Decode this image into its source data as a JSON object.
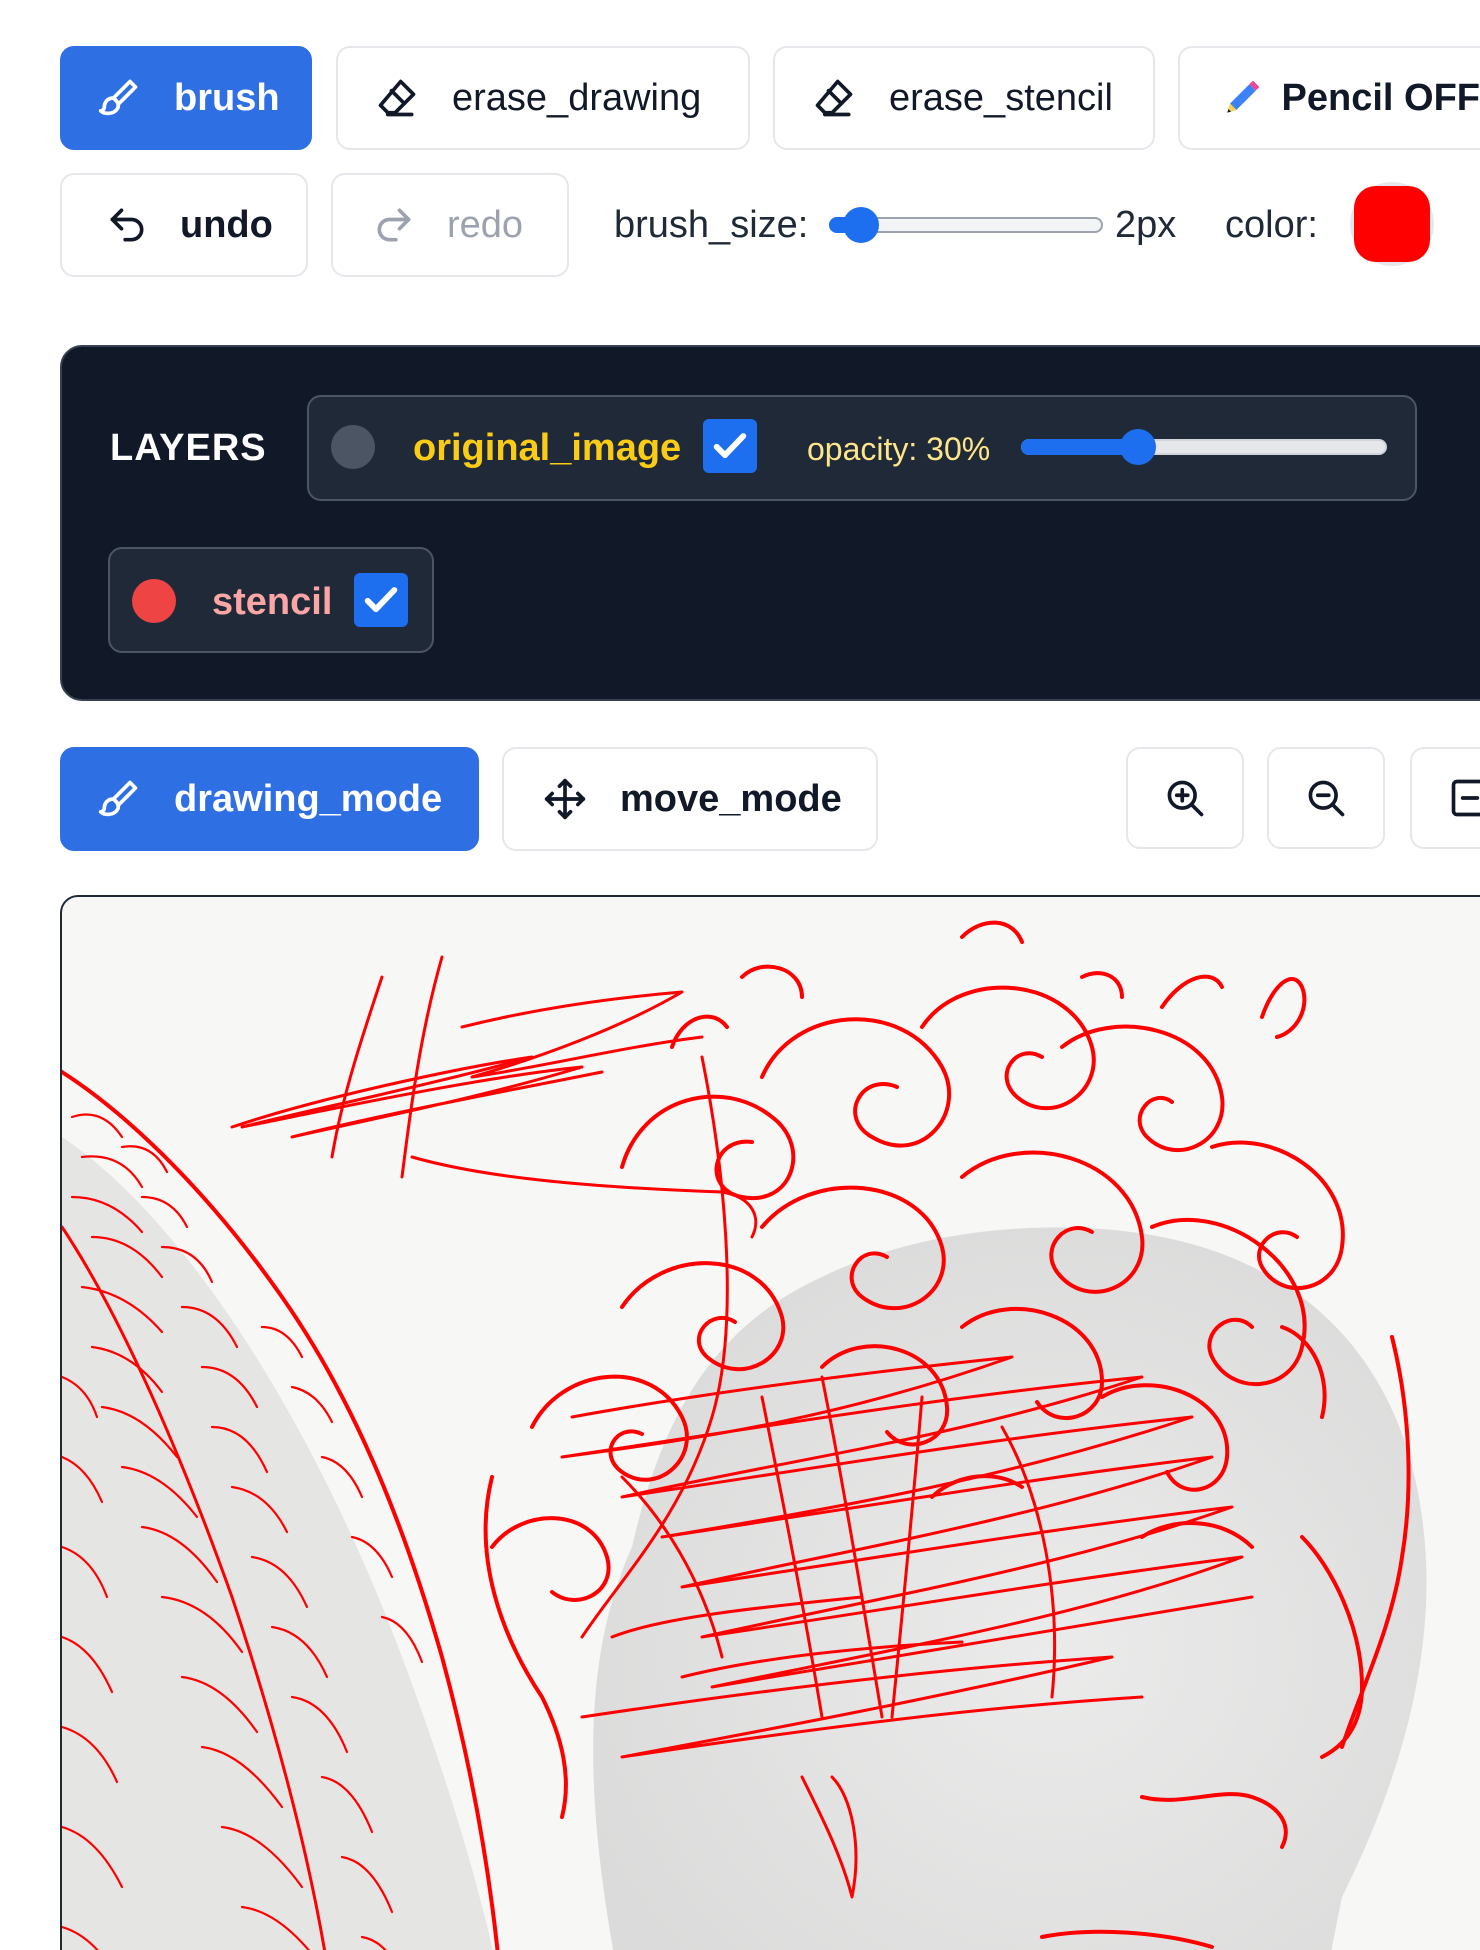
{
  "toolbar": {
    "brush_label": "brush",
    "erase_drawing_label": "erase_drawing",
    "erase_stencil_label": "erase_stencil",
    "pencil_label": "Pencil OFF",
    "undo_label": "undo",
    "redo_label": "redo",
    "brush_size_label": "brush_size:",
    "brush_size_value": "2px",
    "brush_size_fraction": 0.06,
    "color_label": "color:",
    "color_value": "#ff0000"
  },
  "layers": {
    "title": "LAYERS",
    "items": [
      {
        "name": "original_image",
        "checked": true,
        "dot_color": "#4b5563",
        "text_color": "#facc15",
        "opacity_label": "opacity: 30%",
        "opacity_fraction": 0.3
      },
      {
        "name": "stencil",
        "checked": true,
        "dot_color": "#ef4444",
        "text_color": "#fca5a5"
      }
    ]
  },
  "modes": {
    "drawing_label": "drawing_mode",
    "move_label": "move_mode"
  },
  "icons": [
    "brush-icon",
    "eraser-icon",
    "pencil-icon",
    "undo-icon",
    "redo-icon",
    "zoom-in-icon",
    "zoom-out-icon",
    "fit-icon",
    "move-icon",
    "check-icon"
  ]
}
